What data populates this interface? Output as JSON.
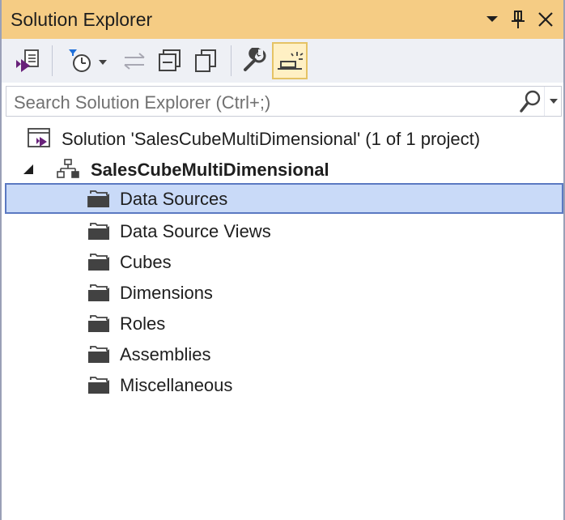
{
  "window": {
    "title": "Solution Explorer"
  },
  "title_buttons": {
    "menu_icon": "dropdown-arrow-icon",
    "pin_icon": "pin-icon",
    "close_icon": "close-icon"
  },
  "toolbar": {
    "buttons": [
      {
        "name": "switch-views-icon"
      },
      {
        "name": "pending-changes-filter-icon"
      },
      {
        "name": "sync-with-active-document-icon"
      },
      {
        "name": "collapse-all-icon"
      },
      {
        "name": "show-all-files-icon"
      },
      {
        "name": "properties-icon"
      },
      {
        "name": "preview-selected-items-icon"
      }
    ],
    "active_button": "preview-selected-items"
  },
  "search": {
    "placeholder": "Search Solution Explorer (Ctrl+;)"
  },
  "tree": {
    "solution_label": "Solution 'SalesCubeMultiDimensional' (1 of 1 project)",
    "project_label": "SalesCubeMultiDimensional",
    "folders": [
      {
        "label": "Data Sources",
        "selected": true
      },
      {
        "label": "Data Source Views",
        "selected": false
      },
      {
        "label": "Cubes",
        "selected": false
      },
      {
        "label": "Dimensions",
        "selected": false
      },
      {
        "label": "Roles",
        "selected": false
      },
      {
        "label": "Assemblies",
        "selected": false
      },
      {
        "label": "Miscellaneous",
        "selected": false
      }
    ]
  },
  "colors": {
    "title_bar": "#f5cc84",
    "toolbar": "#eef0f5",
    "selection_fill": "#c9daf8",
    "selection_border": "#5b79c2",
    "vs_purple": "#68217a"
  }
}
